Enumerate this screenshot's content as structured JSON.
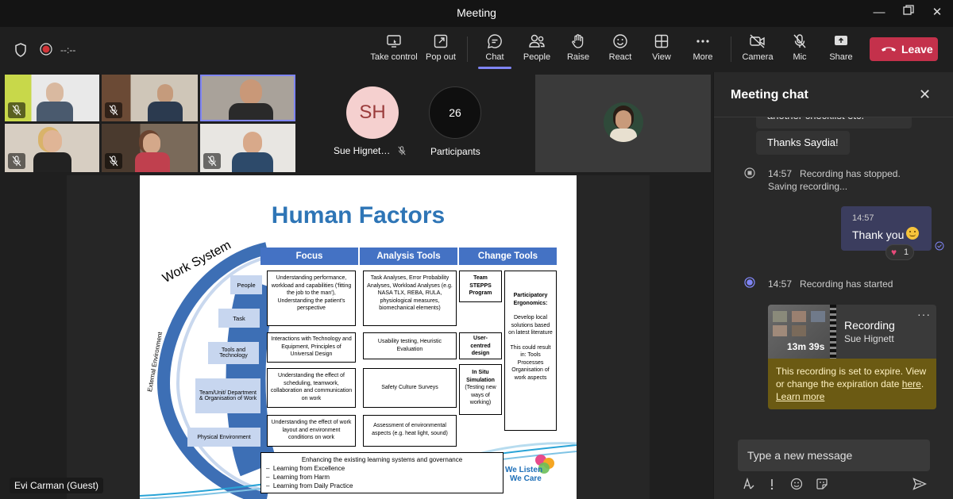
{
  "window": {
    "title": "Meeting"
  },
  "meeting_bar": {
    "timer": "--:--"
  },
  "toolbar": {
    "take_control": "Take control",
    "pop_out": "Pop out",
    "chat": "Chat",
    "people": "People",
    "raise": "Raise",
    "react": "React",
    "view": "View",
    "more": "More",
    "camera": "Camera",
    "mic": "Mic",
    "share": "Share",
    "leave": "Leave"
  },
  "participants": {
    "sh_initials": "SH",
    "sh_name": "Sue Hignet…",
    "count": "26",
    "count_label": "Participants"
  },
  "presenter_label": "Evi Carman (Guest)",
  "slide": {
    "title": "Human Factors",
    "arc_label": "Work System",
    "side_label": "External Environment",
    "headers": [
      "Focus",
      "Analysis Tools",
      "Change Tools"
    ],
    "left_items": [
      "People",
      "Task",
      "Tools and Technology",
      "Team/Unit/ Department & Organisation of Work",
      "Physical Environment"
    ],
    "focus": [
      "Understanding performance, workload and capabilities ('fitting the job to the man'), Understanding the patient's perspective",
      "Interactions with Technology and Equipment, Principles of Universal Design",
      "Understanding the effect of scheduling, teamwork, collaboration and communication on work",
      "Understanding the effect of work layout and environment conditions on work"
    ],
    "analysis": [
      "Task Analyses, Error Probability Analyses, Workload Analyses (e.g. NASA TLX, REBA, RULA, physiological measures, biomechanical elements)",
      "Usability testing, Heuristic Evaluation",
      "Safety Culture Surveys",
      "Assessment of environmental aspects (e.g. heat light, sound)"
    ],
    "change_a": [
      "Team STEPPS Program",
      "User-centred design",
      "In Situ Simulation"
    ],
    "change_a_note": "(Testing new ways of working)",
    "change_b_title": "Participatory Ergonomics:",
    "change_b_body": "Develop local solutions based on latest literature",
    "change_b_result": "This could result in: Tools Processes Organisation of work aspects",
    "bottom_title": "Enhancing the existing learning systems and governance",
    "bottom_items": [
      "Learning from Excellence",
      "Learning from Harm",
      "Learning from Daily Practice"
    ],
    "logo_line1": "We Listen",
    "logo_line2": "We Care"
  },
  "chat": {
    "title": "Meeting chat",
    "partial_message": "another checklist etc.",
    "thanks_message": "Thanks Saydia!",
    "rec_stopped_time": "14:57",
    "rec_stopped_text": "Recording has stopped.",
    "rec_stopped_sub": "Saving recording...",
    "my_time": "14:57",
    "my_message": "Thank you",
    "reaction_count": "1",
    "rec_started_time": "14:57",
    "rec_started_text": "Recording has started",
    "rec_card_title": "Recording",
    "rec_card_owner": "Sue Hignett",
    "rec_duration": "13m 39s",
    "expire_text": "This recording is set to expire. View or change the expiration date",
    "expire_link": "here",
    "learn_more": "Learn more",
    "input_placeholder": "Type a new message"
  },
  "colors": {
    "accent": "#7f85f5",
    "leave": "#c4314b",
    "slide_blue": "#4472c4",
    "title_blue": "#2e75b6"
  }
}
